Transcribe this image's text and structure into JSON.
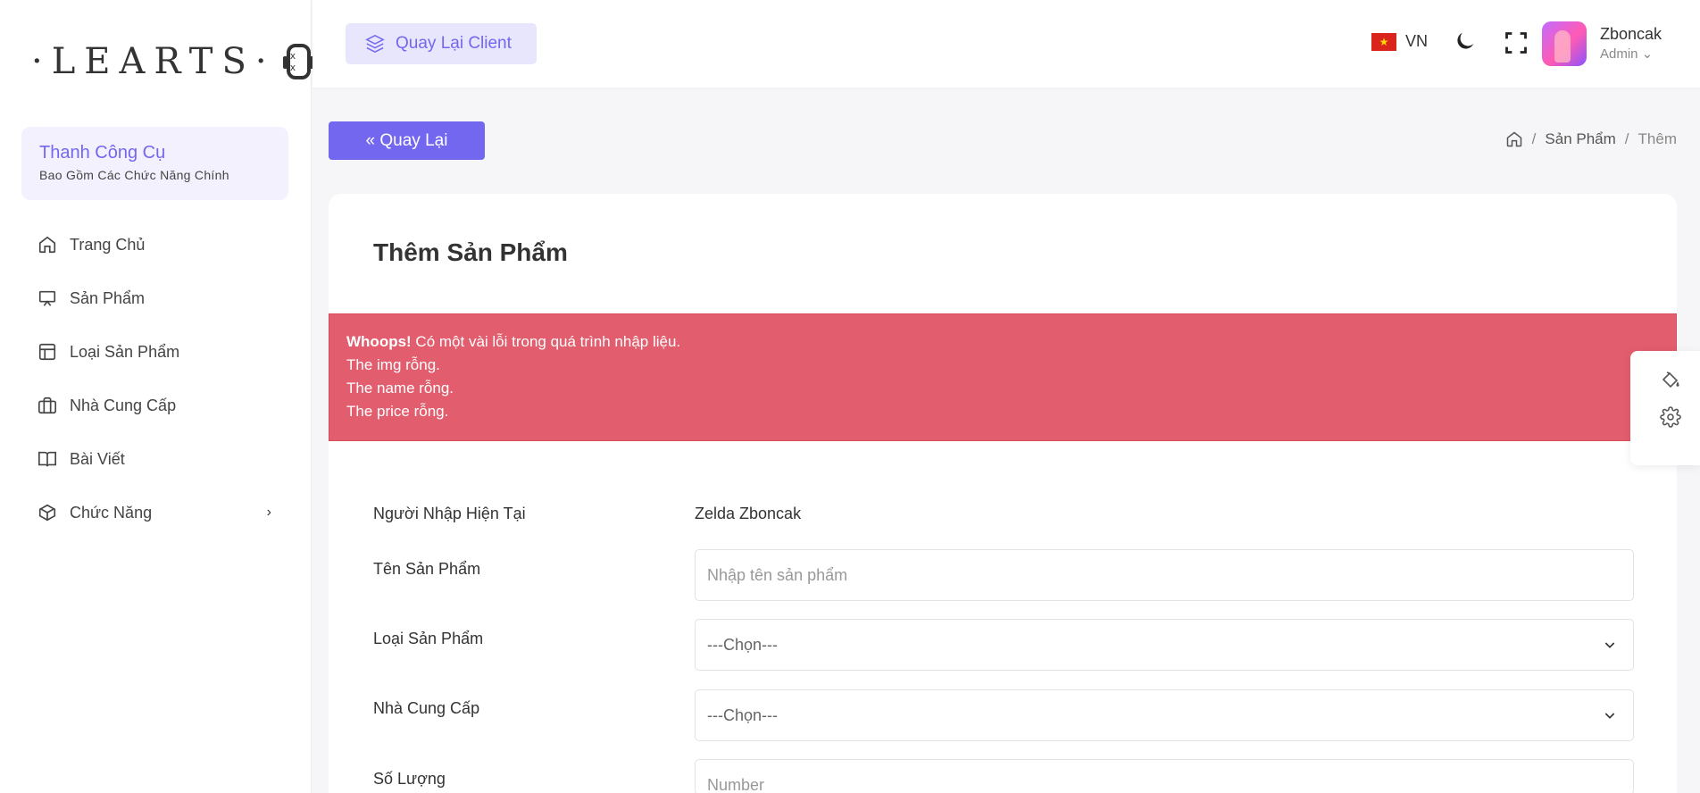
{
  "sidebar": {
    "logo_text": "·LEARTS·",
    "robot_face": "x x",
    "toolbar_title": "Thanh Công Cụ",
    "toolbar_subtitle": "Bao Gồm Các Chức Năng Chính",
    "items": [
      {
        "label": "Trang Chủ",
        "icon": "home-icon"
      },
      {
        "label": "Sản Phẩm",
        "icon": "monitor-icon"
      },
      {
        "label": "Loại Sản Phẩm",
        "icon": "layout-icon"
      },
      {
        "label": "Nhà Cung Cấp",
        "icon": "briefcase-icon"
      },
      {
        "label": "Bài Viết",
        "icon": "book-icon"
      },
      {
        "label": "Chức Năng",
        "icon": "box-icon",
        "chevron": "›"
      }
    ]
  },
  "header": {
    "back_client_label": "Quay Lại Client",
    "language": "VN",
    "flag_star": "★",
    "user_name": "Zboncak",
    "user_role": "Admin ⌄"
  },
  "page": {
    "back_label": "« Quay Lại",
    "breadcrumb": {
      "sep": "/",
      "item1": "Sản Phẩm",
      "item2": "Thêm"
    }
  },
  "card": {
    "title": "Thêm Sản Phẩm",
    "alert": {
      "prefix": "Whoops!",
      "message": " Có một vài lỗi trong quá trình nhập liệu.",
      "errors": [
        "The img rỗng.",
        "The name rỗng.",
        "The price rỗng."
      ]
    },
    "fields": {
      "current_user_label": "Người Nhập Hiện Tại",
      "current_user_value": "Zelda Zboncak",
      "name_label": "Tên Sản Phẩm",
      "name_placeholder": "Nhập tên sản phẩm",
      "category_label": "Loại Sản Phẩm",
      "category_value": "---Chọn---",
      "supplier_label": "Nhà Cung Cấp",
      "supplier_value": "---Chọn---",
      "quantity_label": "Số Lượng",
      "quantity_placeholder": "Number"
    }
  },
  "colors": {
    "accent": "#7367f0",
    "alert": "#e25d6d"
  }
}
